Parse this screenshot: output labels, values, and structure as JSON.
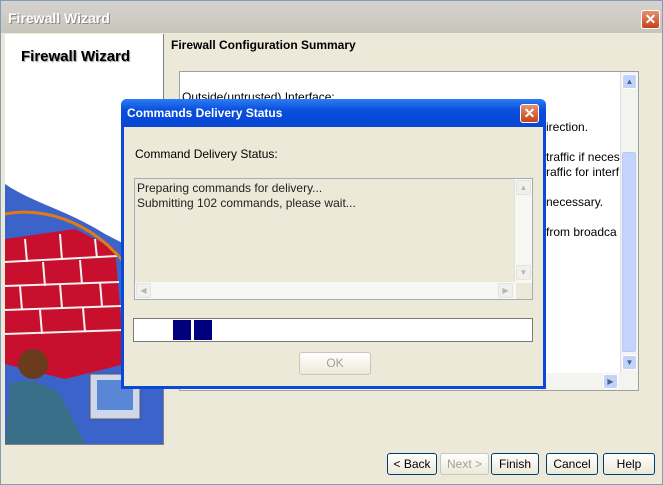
{
  "window": {
    "title": "Firewall Wizard",
    "close_icon": "close-icon"
  },
  "left_panel": {
    "brand": "Firewall Wizard"
  },
  "summary": {
    "title": "Firewall Configuration Summary",
    "lines": [
      "Outside(untrusted) Interface:",
      "irection.",
      "traffic if neces",
      "raffic for interf",
      "necessary.",
      "from broadca"
    ]
  },
  "buttons": {
    "back": "< Back",
    "next": "Next >",
    "finish": "Finish",
    "cancel": "Cancel",
    "help": "Help"
  },
  "dialog": {
    "title": "Commands Delivery Status",
    "status_label": "Command Delivery Status:",
    "log": [
      "Preparing commands for delivery...",
      "Submitting 102 commands, please wait..."
    ],
    "ok": "OK"
  },
  "colors": {
    "titlebar_active": "#0a4edc",
    "progress_block": "#00007f",
    "dialog_bg": "#ece9d8"
  }
}
